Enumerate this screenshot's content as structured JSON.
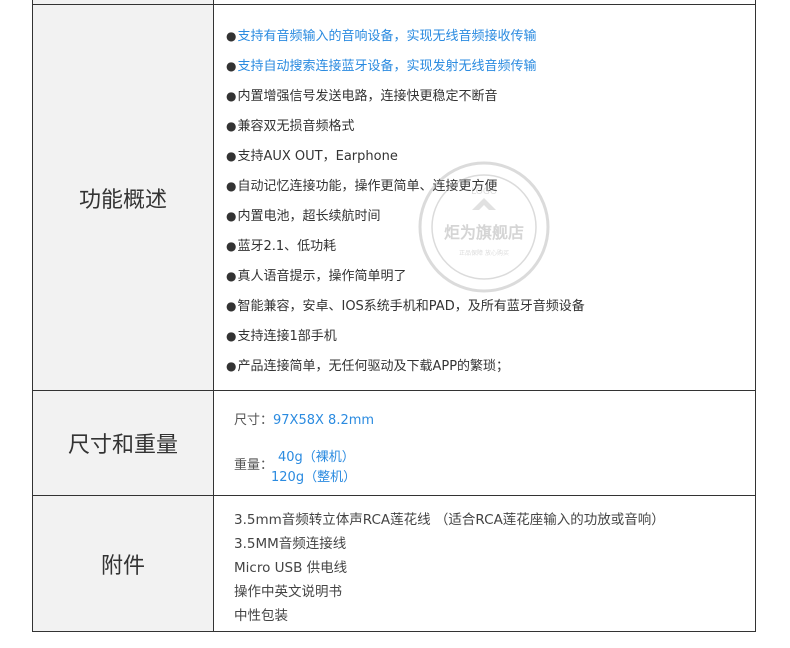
{
  "features": {
    "label": "功能概述",
    "items": [
      {
        "text": "支持有音频输入的音响设备，实现无线音频接收传输",
        "highlight": true
      },
      {
        "text": "支持自动搜索连接蓝牙设备，实现发射无线音频传输",
        "highlight": true
      },
      {
        "text": "内置增强信号发送电路，连接快更稳定不断音",
        "highlight": false
      },
      {
        "text": "兼容双无损音频格式",
        "highlight": false
      },
      {
        "text": "支持AUX OUT，Earphone",
        "highlight": false
      },
      {
        "text": "自动记忆连接功能，操作更简单、连接更方便",
        "highlight": false
      },
      {
        "text": "内置电池，超长续航时间",
        "highlight": false
      },
      {
        "text": "蓝牙2.1、低功耗",
        "highlight": false
      },
      {
        "text": "真人语音提示，操作简单明了",
        "highlight": false
      },
      {
        "text": "智能兼容，安卓、IOS系统手机和PAD，及所有蓝牙音频设备",
        "highlight": false
      },
      {
        "text": "支持连接1部手机",
        "highlight": false
      },
      {
        "text": "产品连接简单，无任何驱动及下载APP的繁琐；",
        "highlight": false
      }
    ],
    "bullet": "●"
  },
  "size": {
    "label": "尺寸和重量",
    "dim_label": "尺寸：",
    "dim_value": "97X58X 8.2mm",
    "weight_label": "重量：",
    "weight_bare": "40g（裸机）",
    "weight_full": "120g（整机）"
  },
  "accessories": {
    "label": "附件",
    "items": [
      "3.5mm音频转立体声RCA莲花线  （适合RCA莲花座输入的功放或音响）",
      "3.5MM音频连接线",
      "Micro USB 供电线",
      "操作中英文说明书",
      "中性包装"
    ]
  },
  "watermark": {
    "main": "炬为旗舰店",
    "top": "LOGO",
    "sub": "正品保障 放心购买"
  }
}
